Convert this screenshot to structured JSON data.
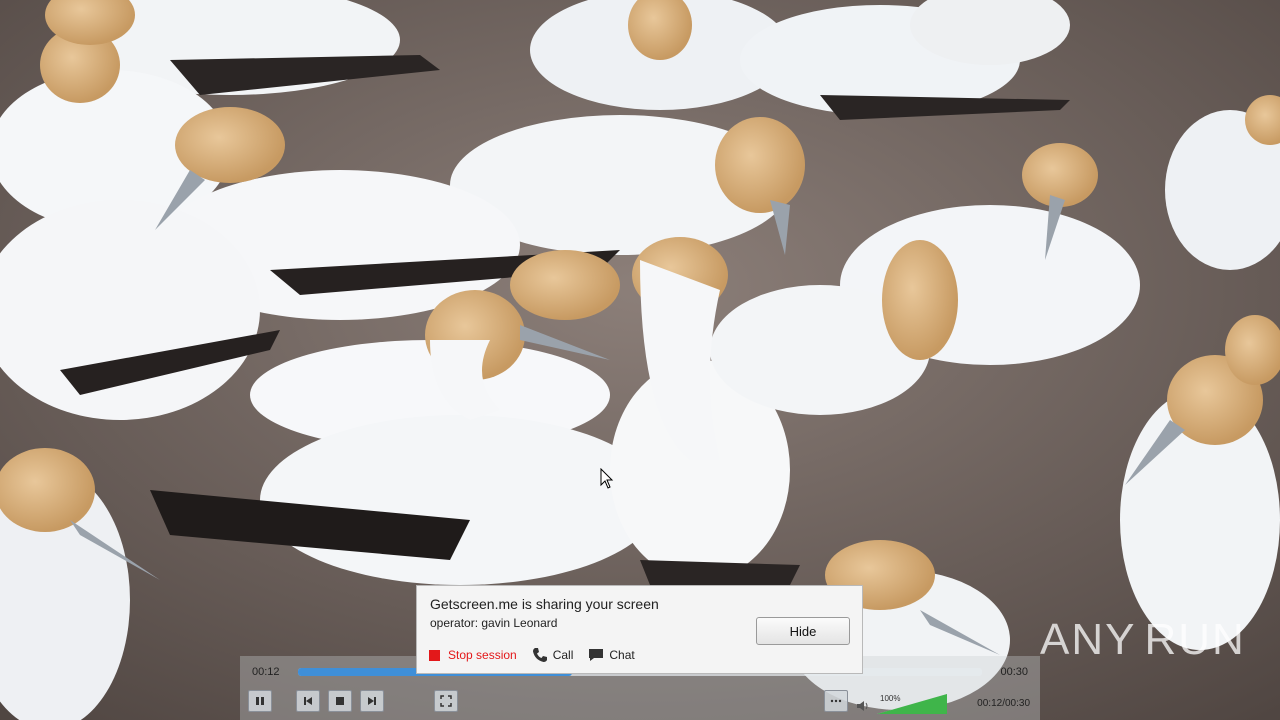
{
  "popup": {
    "title": "Getscreen.me is sharing your screen",
    "operator": "operator: gavin Leonard",
    "hide_label": "Hide",
    "actions": {
      "stop": "Stop session",
      "call": "Call",
      "chat": "Chat"
    },
    "stop_color": "#e3181a"
  },
  "player": {
    "current_time": "00:12",
    "total_time": "00:30",
    "time_readout": "00:12/00:30",
    "progress": 0.4,
    "volume_label": "100%",
    "volume": 1.0,
    "accent": "#3f8fd8"
  },
  "watermark": {
    "text_left": "ANY",
    "text_right": "RUN"
  },
  "icons": {
    "stop": "stop-square-icon",
    "call": "phone-icon",
    "chat": "chat-bubble-icon",
    "cursor": "mouse-pointer-icon"
  }
}
